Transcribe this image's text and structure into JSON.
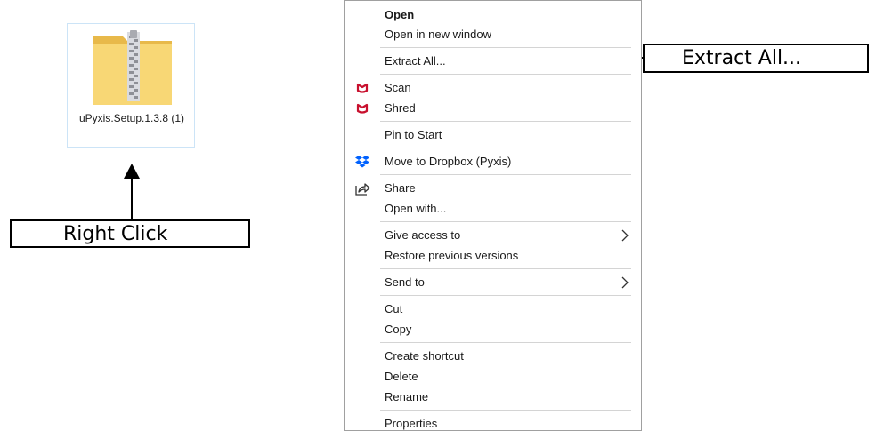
{
  "desktop": {
    "file": {
      "name": "uPyxis.Setup.1.3.8 (1)",
      "icon": "zip-folder-icon"
    }
  },
  "callouts": {
    "right_click": "Right Click",
    "extract_all": "Extract All..."
  },
  "context_menu": {
    "items": {
      "open": {
        "label": "Open"
      },
      "open_new_window": {
        "label": "Open in new window"
      },
      "extract_all": {
        "label": "Extract All..."
      },
      "scan": {
        "label": "Scan",
        "icon": "mcafee-icon"
      },
      "shred": {
        "label": "Shred",
        "icon": "mcafee-icon"
      },
      "pin_to_start": {
        "label": "Pin to Start"
      },
      "move_to_dropbox": {
        "label": "Move to Dropbox (Pyxis)",
        "icon": "dropbox-icon"
      },
      "share": {
        "label": "Share",
        "icon": "share-icon"
      },
      "open_with": {
        "label": "Open with..."
      },
      "give_access_to": {
        "label": "Give access to",
        "submenu": true
      },
      "restore_previous_versions": {
        "label": "Restore previous versions"
      },
      "send_to": {
        "label": "Send to",
        "submenu": true
      },
      "cut": {
        "label": "Cut"
      },
      "copy": {
        "label": "Copy"
      },
      "create_shortcut": {
        "label": "Create shortcut"
      },
      "delete": {
        "label": "Delete"
      },
      "rename": {
        "label": "Rename"
      },
      "properties": {
        "label": "Properties"
      }
    }
  },
  "colors": {
    "folder_yellow": "#f8d775",
    "folder_shade": "#e8b94a",
    "mcafee_red": "#c8102e",
    "dropbox_blue": "#0061fe",
    "menu_border": "#a0a0a0",
    "tile_border": "#cce4f7"
  }
}
